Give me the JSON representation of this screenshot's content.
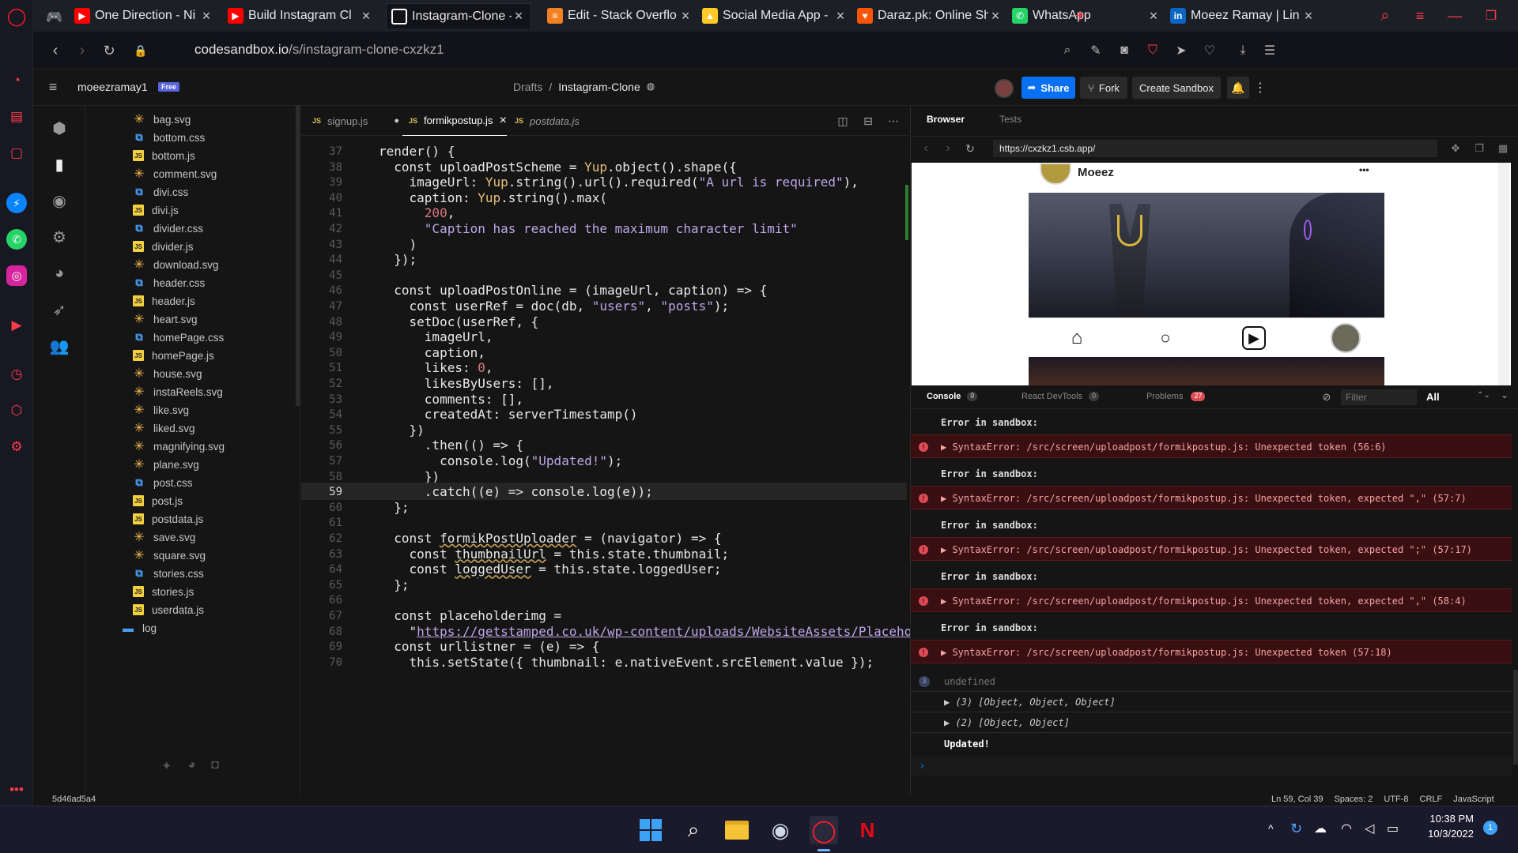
{
  "browser": {
    "tabs": [
      {
        "title": "One Direction - Ni",
        "icon": "youtube-icon",
        "color": "#ff0000"
      },
      {
        "title": "Build Instagram Cl",
        "icon": "youtube-icon",
        "color": "#ff0000"
      },
      {
        "title": "Instagram-Clone -",
        "icon": "codesandbox-icon",
        "color": "#ffffff",
        "active": true
      },
      {
        "title": "Edit - Stack Overflo",
        "icon": "stackoverflow-icon",
        "color": "#f48024"
      },
      {
        "title": "Social Media App -",
        "icon": "firebase-icon",
        "color": "#ffca28"
      },
      {
        "title": "Daraz.pk: Online Sh",
        "icon": "daraz-icon",
        "color": "#f85606"
      },
      {
        "title": "WhatsApp",
        "icon": "whatsapp-icon",
        "color": "#25d366"
      },
      {
        "title": "Moeez Ramay | Lin",
        "icon": "linkedin-icon",
        "color": "#0a66c2"
      }
    ],
    "url_host": "codesandbox.io",
    "url_path": "/s/instagram-clone-cxzkz1"
  },
  "header": {
    "username": "moeezramay1",
    "plan": "Free",
    "crumb_parent": "Drafts",
    "crumb_sep": "/",
    "crumb_current": "Instagram-Clone",
    "share": "Share",
    "fork": "Fork",
    "create": "Create Sandbox"
  },
  "files": [
    {
      "name": "bag.svg",
      "type": "svg"
    },
    {
      "name": "bottom.css",
      "type": "css"
    },
    {
      "name": "bottom.js",
      "type": "js"
    },
    {
      "name": "comment.svg",
      "type": "svg"
    },
    {
      "name": "divi.css",
      "type": "css"
    },
    {
      "name": "divi.js",
      "type": "js"
    },
    {
      "name": "divider.css",
      "type": "css"
    },
    {
      "name": "divider.js",
      "type": "js"
    },
    {
      "name": "download.svg",
      "type": "svg"
    },
    {
      "name": "header.css",
      "type": "css"
    },
    {
      "name": "header.js",
      "type": "js"
    },
    {
      "name": "heart.svg",
      "type": "svg"
    },
    {
      "name": "homePage.css",
      "type": "css"
    },
    {
      "name": "homePage.js",
      "type": "js"
    },
    {
      "name": "house.svg",
      "type": "svg"
    },
    {
      "name": "instaReels.svg",
      "type": "svg"
    },
    {
      "name": "like.svg",
      "type": "svg"
    },
    {
      "name": "liked.svg",
      "type": "svg"
    },
    {
      "name": "magnifying.svg",
      "type": "svg"
    },
    {
      "name": "plane.svg",
      "type": "svg"
    },
    {
      "name": "post.css",
      "type": "css"
    },
    {
      "name": "post.js",
      "type": "js"
    },
    {
      "name": "postdata.js",
      "type": "js"
    },
    {
      "name": "save.svg",
      "type": "svg"
    },
    {
      "name": "square.svg",
      "type": "svg"
    },
    {
      "name": "stories.css",
      "type": "css"
    },
    {
      "name": "stories.js",
      "type": "js"
    },
    {
      "name": "userdata.js",
      "type": "js"
    },
    {
      "name": "log",
      "type": "folder"
    }
  ],
  "editor": {
    "tabs": [
      {
        "label": "signup.js",
        "state": "modified"
      },
      {
        "label": "formikpostup.js",
        "state": "active"
      },
      {
        "label": "postdata.js",
        "state": "preview"
      }
    ],
    "modified_mark": "●",
    "close_mark": "×",
    "lines": [
      {
        "n": "37",
        "html": "render() {"
      },
      {
        "n": "38",
        "html": "  const uploadPostScheme = <span class=\"cls\">Yup</span>.object().shape({"
      },
      {
        "n": "39",
        "html": "    imageUrl: <span class=\"cls\">Yup</span>.string().url().required(<span class=\"str\">\"A url is required\"</span>),"
      },
      {
        "n": "40",
        "html": "    caption: <span class=\"cls\">Yup</span>.string().max("
      },
      {
        "n": "41",
        "html": "      <span class=\"num\">200</span>,"
      },
      {
        "n": "42",
        "html": "      <span class=\"str\">\"Caption has reached the maximum character limit\"</span>"
      },
      {
        "n": "43",
        "html": "    )"
      },
      {
        "n": "44",
        "html": "  });"
      },
      {
        "n": "45",
        "html": ""
      },
      {
        "n": "46",
        "html": "  const uploadPostOnline = (imageUrl, caption) =&gt; {"
      },
      {
        "n": "47",
        "html": "    const userRef = doc(db, <span class=\"str\">\"users\"</span>, <span class=\"str\">\"posts\"</span>);"
      },
      {
        "n": "48",
        "html": "    setDoc(userRef, {"
      },
      {
        "n": "49",
        "html": "      imageUrl,"
      },
      {
        "n": "50",
        "html": "      caption,"
      },
      {
        "n": "51",
        "html": "      likes: <span class=\"num\">0</span>,"
      },
      {
        "n": "52",
        "html": "      likesByUsers: [],"
      },
      {
        "n": "53",
        "html": "      comments: [],"
      },
      {
        "n": "54",
        "html": "      createdAt: serverTimestamp()"
      },
      {
        "n": "55",
        "html": "    })"
      },
      {
        "n": "56",
        "html": "      .then(() =&gt; {"
      },
      {
        "n": "57",
        "html": "        console.log(<span class=\"str\">\"Updated!\"</span>);"
      },
      {
        "n": "58",
        "html": "      })"
      },
      {
        "n": "59",
        "html": "      .catch((e) =&gt; console.log(e));"
      },
      {
        "n": "60",
        "html": "  };"
      },
      {
        "n": "61",
        "html": ""
      },
      {
        "n": "62",
        "html": "  const <span class=\"sq\">formikPostUploader</span> = (navigator) =&gt; {"
      },
      {
        "n": "63",
        "html": "    const <span class=\"sq\">thumbnailUrl</span> = this.state.thumbnail;"
      },
      {
        "n": "64",
        "html": "    const <span class=\"sq\">loggedUser</span> = this.state.loggedUser;"
      },
      {
        "n": "65",
        "html": "  };"
      },
      {
        "n": "66",
        "html": ""
      },
      {
        "n": "67",
        "html": "  const placeholderimg ="
      },
      {
        "n": "68",
        "html": "    \"<span class=\"url\">https://getstamped.co.uk/wp-content/uploads/WebsiteAssets/Placeho</span>"
      },
      {
        "n": "69",
        "html": "  const urllistner = (e) =&gt; {"
      },
      {
        "n": "70",
        "html": "    this.setState({ thumbnail: e.nativeEvent.srcElement.value });"
      }
    ]
  },
  "preview": {
    "tab_browser": "Browser",
    "tab_tests": "Tests",
    "url": "https://cxzkz1.csb.app/",
    "post_user": "Moeez",
    "more": "•••"
  },
  "console": {
    "tab_console": "Console",
    "console_count": "0",
    "tab_devtools": "React DevTools",
    "devtools_count": "0",
    "tab_problems": "Problems",
    "problems_count": "27",
    "filter_placeholder": "Filter",
    "level": "All",
    "errors": [
      {
        "head": "Error in sandbox:",
        "msg": "▶ SyntaxError: /src/screen/uploadpost/formikpostup.js: Unexpected token (56:6)"
      },
      {
        "head": "Error in sandbox:",
        "msg": "▶ SyntaxError: /src/screen/uploadpost/formikpostup.js: Unexpected token, expected \",\" (57:7)"
      },
      {
        "head": "Error in sandbox:",
        "msg": "▶ SyntaxError: /src/screen/uploadpost/formikpostup.js: Unexpected token, expected \";\" (57:17)"
      },
      {
        "head": "Error in sandbox:",
        "msg": "▶ SyntaxError: /src/screen/uploadpost/formikpostup.js: Unexpected token, expected \",\" (58:4)"
      },
      {
        "head": "Error in sandbox:",
        "msg": "▶ SyntaxError: /src/screen/uploadpost/formikpostup.js: Unexpected token (57:18)"
      }
    ],
    "undefined_line": "undefined",
    "log1": "▶ (3) [Object, Object, Object]",
    "log2": "▶ (2) [Object, Object]",
    "updated": "Updated!",
    "undefined_badge": "3",
    "prompt": "›"
  },
  "status": {
    "hash": "5d46ad5a4",
    "position": "Ln 59, Col 39",
    "spaces": "Spaces: 2",
    "encoding": "UTF-8",
    "eol": "CRLF",
    "language": "JavaScript"
  },
  "taskbar": {
    "time": "10:38 PM",
    "date": "10/3/2022",
    "notif": "1"
  }
}
